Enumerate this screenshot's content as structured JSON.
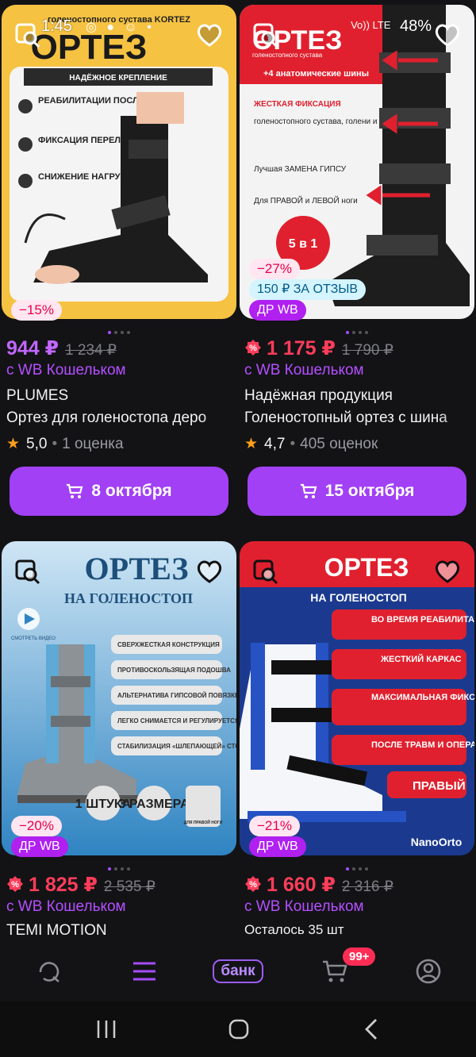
{
  "status_bar": {
    "time": "1:45",
    "battery": "48%",
    "net_label": "Vo)) LTE"
  },
  "products": [
    {
      "image": {
        "headline_top": "голеностопного сустава KORTEZ",
        "headline": "ОРТЕЗ",
        "ribbon": "НАДЁЖНОЕ КРЕПЛЕНИЕ",
        "features": [
          "РЕАБИЛИТАЦИИ ПОСЛЕ ТРАВМ",
          "ФИКСАЦИЯ ПЕРЕЛОМА",
          "СНИЖЕНИЕ НАГРУЗКИ"
        ],
        "bg": "#f6c242"
      },
      "discount": "−15%",
      "price": "944 ₽",
      "old_price": "1 234 ₽",
      "wallet": "с WB Кошельком",
      "brand": "PLUMES",
      "title": "Ортез для голеностопа деро",
      "rating": "5,0",
      "reviews": "1 оценка",
      "button": "8 октября"
    },
    {
      "image": {
        "headline_top": "голеностопного сустава",
        "headline": "ОРТЕЗ",
        "sub": "+4 анатомические шины",
        "lines": [
          "ЖЕСТКАЯ ФИКСАЦИЯ",
          "голеностопного сустава, голени и стопы",
          "Лучшая ЗАМЕНА ГИПСУ",
          "Для ПРАВОЙ и ЛЕВОЙ ноги"
        ],
        "tag": "5 в 1"
      },
      "discount": "−27%",
      "review_badge": "150 ₽ ЗА ОТЗЫВ",
      "dr_badge": "ДР WB",
      "price": "1 175 ₽",
      "old_price": "1 790 ₽",
      "wallet": "с WB Кошельком",
      "brand": "Надёжная продукция",
      "title": "Голеностопный ортез с шина",
      "rating": "4,7",
      "reviews": "405 оценок",
      "button": "15 октября"
    },
    {
      "image": {
        "headline": "ОРТЕЗ",
        "sub": "НА ГОЛЕНОСТОП",
        "video": "СМОТРЕТЬ ВИДЕО",
        "features": [
          "СВЕРХЖЕСТКАЯ КОНСТРУКЦИЯ",
          "ПРОТИВОСКОЛЬЗЯЩАЯ ПОДОШВА",
          "АЛЬТЕРНАТИВА ГИПСОВОЙ ПОВЯЗКЕ",
          "ЛЕГКО СНИМАЕТСЯ И РЕГУЛИРУЕТСЯ",
          "СТАБИЛИЗАЦИЯ «ШЛЕПАЮЩЕЙ» СТОПЫ"
        ],
        "chips": [
          "1 ШТУКА",
          "3 РАЗМЕРА",
          "ДЛЯ ПРАВОЙ НОГИ"
        ]
      },
      "discount": "−20%",
      "dr_badge": "ДР WB",
      "price": "1 825 ₽",
      "old_price": "2 535 ₽",
      "wallet": "с WB Кошельком",
      "brand": "TEMI MOTION"
    },
    {
      "image": {
        "headline": "ОРТЕЗ",
        "sub": "НА ГОЛЕНОСТОП",
        "features": [
          "ВО ВРЕМЯ РЕАБИЛИТАЦИИ",
          "ЖЕСТКИЙ КАРКАС",
          "МАКСИМАЛЬНАЯ ФИКСАЦИЯ СУСТАВА",
          "ПОСЛЕ ТРАВМ И ОПЕРАЦИИ",
          "ПРАВЫЙ"
        ],
        "maker": "NanoOrto"
      },
      "discount": "−21%",
      "dr_badge": "ДР WB",
      "price": "1 660 ₽",
      "old_price": "2 316 ₽",
      "wallet": "с WB Кошельком",
      "stock": "Осталось 35 шт"
    }
  ],
  "tabbar": {
    "bank": "банк",
    "cart_count": "99+"
  }
}
